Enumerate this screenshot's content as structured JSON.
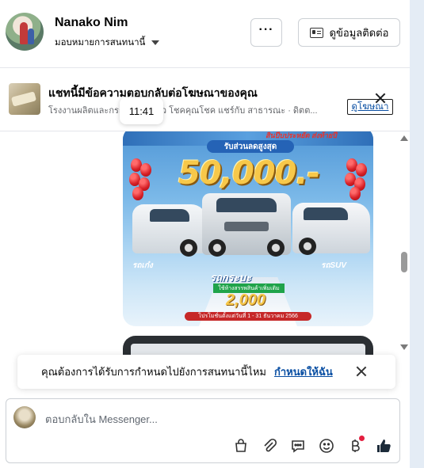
{
  "header": {
    "name": "Nanako Nim",
    "assign_label": "มอบหมายการสนทนานี้",
    "more_label": "···",
    "contact_label": "ดูข้อมูลติดต่อ"
  },
  "ad_banner": {
    "title": "แชทนี้มีข้อความตอบกลับต่อโฆษณาของคุณ",
    "subtitle": "โรงงานผลิตและกระ... ...ใช้แล้ว โชคคุณโชค แชร์กับ สาธารณะ · ดิตต...",
    "view_ad_label": "ดูโฆษณา",
    "timestamp": "11:41"
  },
  "ad_image": {
    "subheading": "รับส่วนลดสูงสุด",
    "headline": "50,000.-",
    "left_label": "รถเก๋ง",
    "middle_label": "รถกระบะ",
    "right_label": "รถSUV",
    "price_note": "ใช้ห้างสรรพสินค้าเพิ่มเติม",
    "price": "2,000",
    "promo_strip": "โปรโมชั่นตั้งแต่วันที่ 1 - 31 ธันวาคม 2566",
    "top_tag": "สินปีบประหยัด ส่งท้ายปี"
  },
  "assign_prompt": {
    "text": "คุณต้องการได้รับการกำหนดไปยังการสนทนานี้ไหม",
    "link": "กำหนดให้ฉัน"
  },
  "composer": {
    "placeholder": "ตอบกลับใน Messenger..."
  },
  "tools": [
    "bag-icon",
    "paperclip-icon",
    "chat-bubble-icon",
    "emoji-icon",
    "baht-icon",
    "thumbs-up-icon"
  ],
  "colors": {
    "link": "#0a4fa3",
    "badge": "#e41e3f",
    "divider": "#e4e6eb"
  }
}
